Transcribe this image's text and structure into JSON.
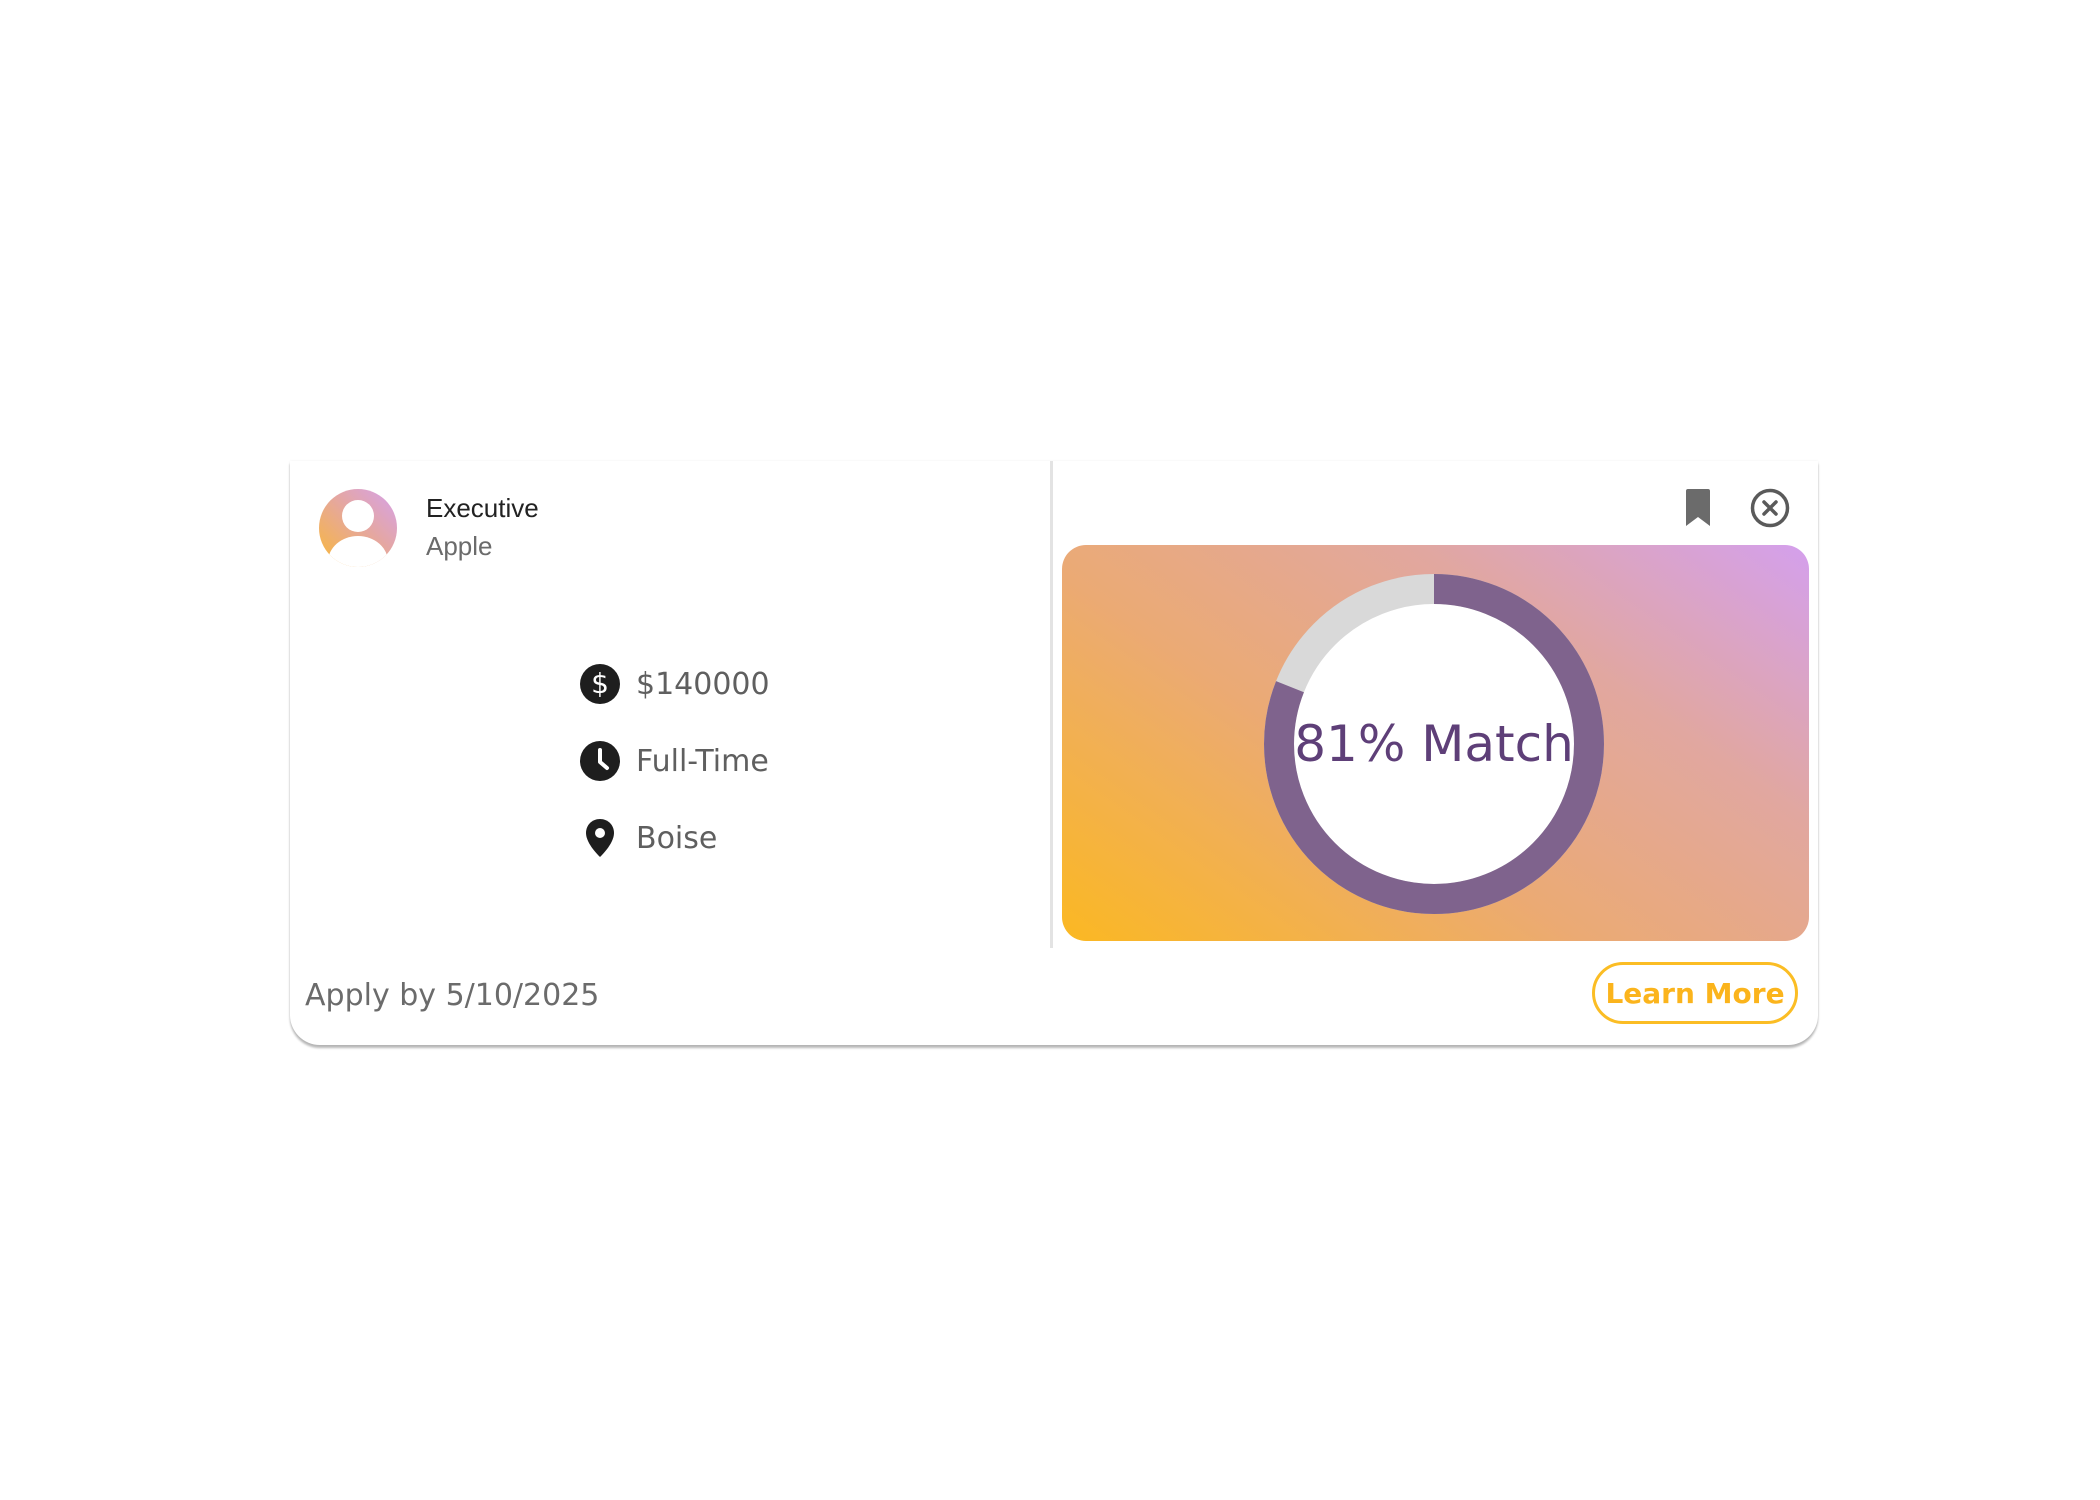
{
  "job": {
    "title": "Executive",
    "company": "Apple"
  },
  "details": {
    "salary": {
      "icon": "dollar-icon",
      "value": "$140000"
    },
    "type": {
      "icon": "clock-icon",
      "value": "Full-Time"
    },
    "location": {
      "icon": "location-pin-icon",
      "value": "Boise"
    }
  },
  "match": {
    "percent": 81,
    "label": "81% Match"
  },
  "footer": {
    "apply_by": "Apply by 5/10/2025",
    "learn_more_label": "Learn More"
  },
  "actions": {
    "bookmark_icon": "bookmark-icon",
    "close_icon": "close-circle-icon"
  },
  "colors": {
    "accent": "#fbbd24",
    "ring_fill": "#7f638d",
    "ring_track": "#d9d9d9",
    "match_text": "#5e3f78"
  }
}
